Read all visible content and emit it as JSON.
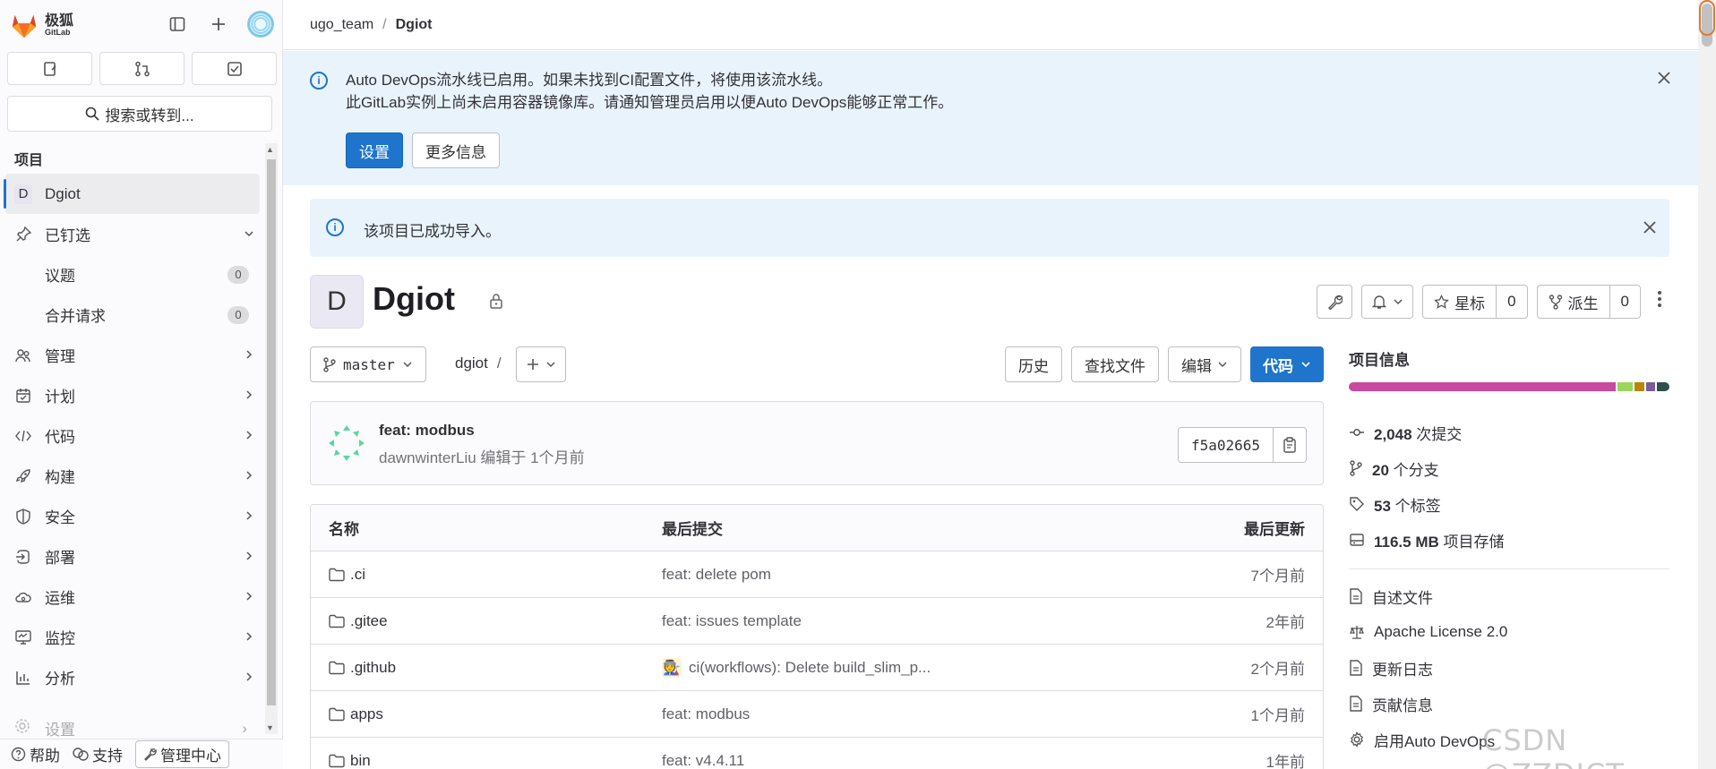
{
  "brand": {
    "cn": "极狐",
    "en": "GitLab",
    "accent": "#1f75cb",
    "logo_color": "#e24329"
  },
  "sidebar": {
    "search_label": "搜索或转到...",
    "section_heading": "项目",
    "project": {
      "initial": "D",
      "name": "Dgiot"
    },
    "pinned": {
      "label": "已钉选",
      "items": [
        {
          "label": "议题",
          "count": "0"
        },
        {
          "label": "合并请求",
          "count": "0"
        }
      ]
    },
    "items": [
      {
        "label": "管理",
        "icon": "users-icon"
      },
      {
        "label": "计划",
        "icon": "calendar-icon"
      },
      {
        "label": "代码",
        "icon": "code-icon"
      },
      {
        "label": "构建",
        "icon": "rocket-icon"
      },
      {
        "label": "安全",
        "icon": "shield-icon"
      },
      {
        "label": "部署",
        "icon": "deploy-icon"
      },
      {
        "label": "运维",
        "icon": "cloud-gear-icon"
      },
      {
        "label": "监控",
        "icon": "monitor-icon"
      },
      {
        "label": "分析",
        "icon": "chart-icon"
      }
    ],
    "faded_item": "设置",
    "footer": {
      "help": "帮助",
      "support": "支持",
      "admin": "管理中心"
    }
  },
  "breadcrumb": {
    "group": "ugo_team",
    "project": "Dgiot"
  },
  "alert_devops": {
    "line1": "Auto DevOps流水线已启用。如果未找到CI配置文件，将使用该流水线。",
    "line2": "此GitLab实例上尚未启用容器镜像库。请通知管理员启用以便Auto DevOps能够正常工作。",
    "primary_btn": "设置",
    "secondary_btn": "更多信息"
  },
  "alert_import": {
    "text": "该项目已成功导入。"
  },
  "project": {
    "initial": "D",
    "title": "Dgiot",
    "star_label": "星标",
    "star_count": "0",
    "fork_label": "派生",
    "fork_count": "0"
  },
  "repo": {
    "branch": "master",
    "path": "dgiot",
    "path_sep": "/",
    "actions": {
      "history": "历史",
      "find": "查找文件",
      "edit": "编辑",
      "code": "代码"
    }
  },
  "commit": {
    "title": "feat: modbus",
    "author": "dawnwinterLiu",
    "meta": "编辑于 1个月前",
    "sha": "f5a02665"
  },
  "files": {
    "headers": {
      "name": "名称",
      "last_commit": "最后提交",
      "last_update": "最后更新"
    },
    "rows": [
      {
        "name": ".ci",
        "commit": "feat: delete pom",
        "updated": "7个月前"
      },
      {
        "name": ".gitee",
        "commit": "feat: issues template",
        "updated": "2年前"
      },
      {
        "name": ".github",
        "commit": "ci(workflows): Delete build_slim_p...",
        "updated": "2个月前",
        "avatar": "🧑‍🏭"
      },
      {
        "name": "apps",
        "commit": "feat: modbus",
        "updated": "1个月前"
      },
      {
        "name": "bin",
        "commit": "feat: v4.4.11",
        "updated": "1年前"
      }
    ]
  },
  "info": {
    "heading": "项目信息",
    "lang_colors": [
      "#c94a9e",
      "#9bd55c",
      "#b8860b",
      "#7a5c99",
      "#2f4f4f"
    ],
    "lang_fractions": [
      0.85,
      0.05,
      0.03,
      0.03,
      0.04
    ],
    "commits": "2,048",
    "commits_label": "次提交",
    "branches": "20",
    "branches_label": "个分支",
    "tags": "53",
    "tags_label": "个标签",
    "storage": "116.5 MB",
    "storage_label": "项目存储",
    "links": [
      "自述文件",
      "Apache License 2.0",
      "更新日志",
      "贡献信息",
      "启用Auto DevOps"
    ]
  },
  "watermark": "CSDN @ZZDICT"
}
